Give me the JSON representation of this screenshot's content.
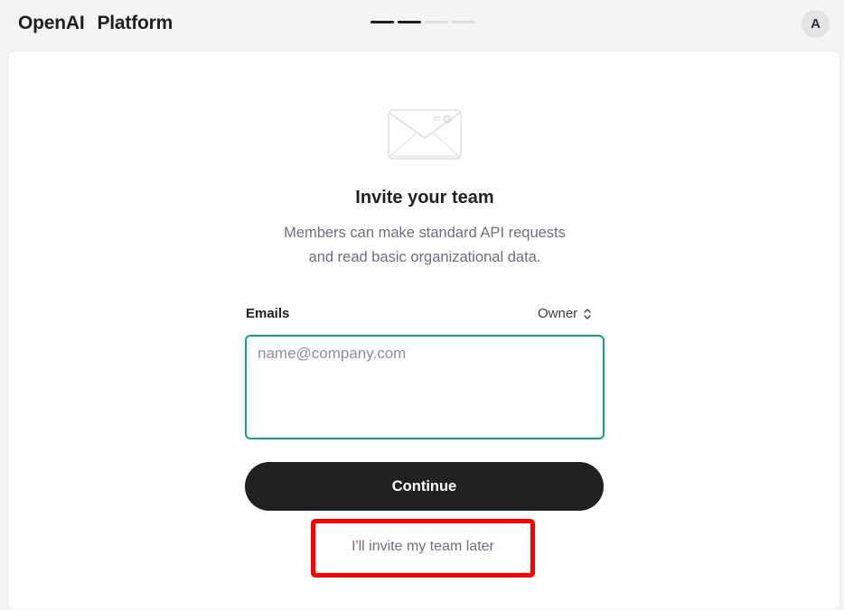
{
  "header": {
    "brand_name": "OpenAI",
    "brand_product": "Platform",
    "progress": {
      "total_steps": 4,
      "completed_steps": 2
    },
    "avatar_initial": "A"
  },
  "invite": {
    "icon": "envelope-icon",
    "title": "Invite your team",
    "subtitle_line1": "Members can make standard API requests",
    "subtitle_line2": "and read basic organizational data.",
    "emails_label": "Emails",
    "role_value": "Owner",
    "emails_placeholder": "name@company.com",
    "emails_value": "",
    "continue_label": "Continue",
    "skip_label": "I'll invite my team later"
  },
  "colors": {
    "accent": "#10a37f",
    "primary_button": "#202123",
    "highlight_annotation": "#ff0000"
  }
}
